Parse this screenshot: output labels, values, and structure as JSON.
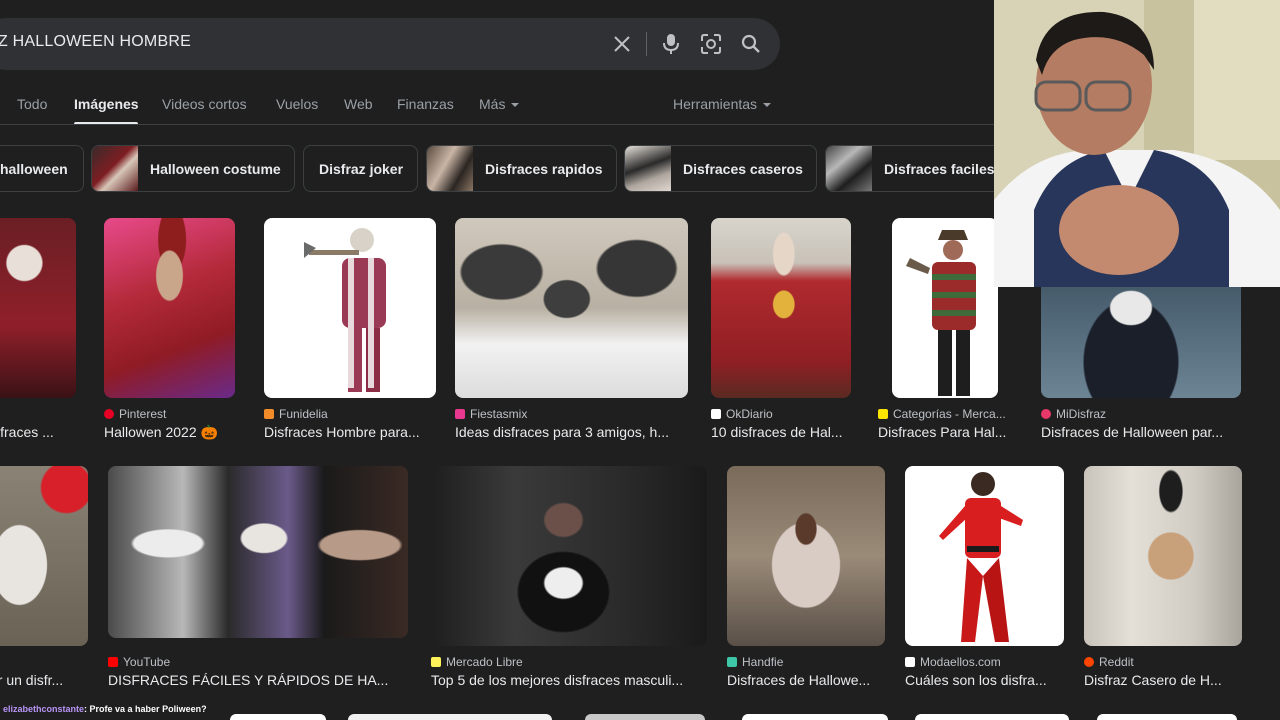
{
  "search": {
    "query": "Z HALLOWEEN HOMBRE",
    "clear_icon": "close-icon",
    "voice_icon": "mic-icon",
    "lens_icon": "camera-lens-icon",
    "search_icon": "search-icon"
  },
  "tabs": [
    {
      "label": "Todo"
    },
    {
      "label": "Imágenes",
      "active": true
    },
    {
      "label": "Videos cortos"
    },
    {
      "label": "Vuelos"
    },
    {
      "label": "Web"
    },
    {
      "label": "Finanzas"
    },
    {
      "label": "Más"
    }
  ],
  "tools_label": "Herramientas",
  "chips": [
    {
      "label": "halloween"
    },
    {
      "label": "Halloween costume"
    },
    {
      "label": "Disfraz joker"
    },
    {
      "label": "Disfraces rapidos"
    },
    {
      "label": "Disfraces caseros"
    },
    {
      "label": "Disfraces faciles"
    }
  ],
  "results_row1": [
    {
      "source": "",
      "title": "isfraces ..."
    },
    {
      "source": "Pinterest",
      "title": "Hallowen 2022 🎃"
    },
    {
      "source": "Funidelia",
      "title": "Disfraces Hombre para..."
    },
    {
      "source": "Fiestasmix",
      "title": "Ideas disfraces para 3 amigos, h..."
    },
    {
      "source": "OkDiario",
      "title": "10 disfraces de Hal..."
    },
    {
      "source": "Categorías - Merca...",
      "title": "Disfraces Para Hal..."
    },
    {
      "source": "MiDisfraz",
      "title": "Disfraces de Halloween par..."
    }
  ],
  "results_row2": [
    {
      "source": "f",
      "title": "er un disfr..."
    },
    {
      "source": "YouTube",
      "title": "DISFRACES FÁCILES Y RÁPIDOS DE HA..."
    },
    {
      "source": "Mercado Libre",
      "title": "Top 5 de los mejores disfraces masculi..."
    },
    {
      "source": "Handfie",
      "title": "Disfraces de Hallowe..."
    },
    {
      "source": "Modaellos.com",
      "title": "Cuáles son los disfra..."
    },
    {
      "source": "Reddit",
      "title": "Disfraz Casero de H..."
    }
  ],
  "chat": {
    "user": "elizabethconstante",
    "message": " Profe va a haber Poliween?"
  },
  "colors": {
    "background": "#1f1f1f",
    "searchbar": "#303134",
    "text_primary": "#e8eaed",
    "text_secondary": "#9aa0a6",
    "chat_user": "#b794f6"
  }
}
